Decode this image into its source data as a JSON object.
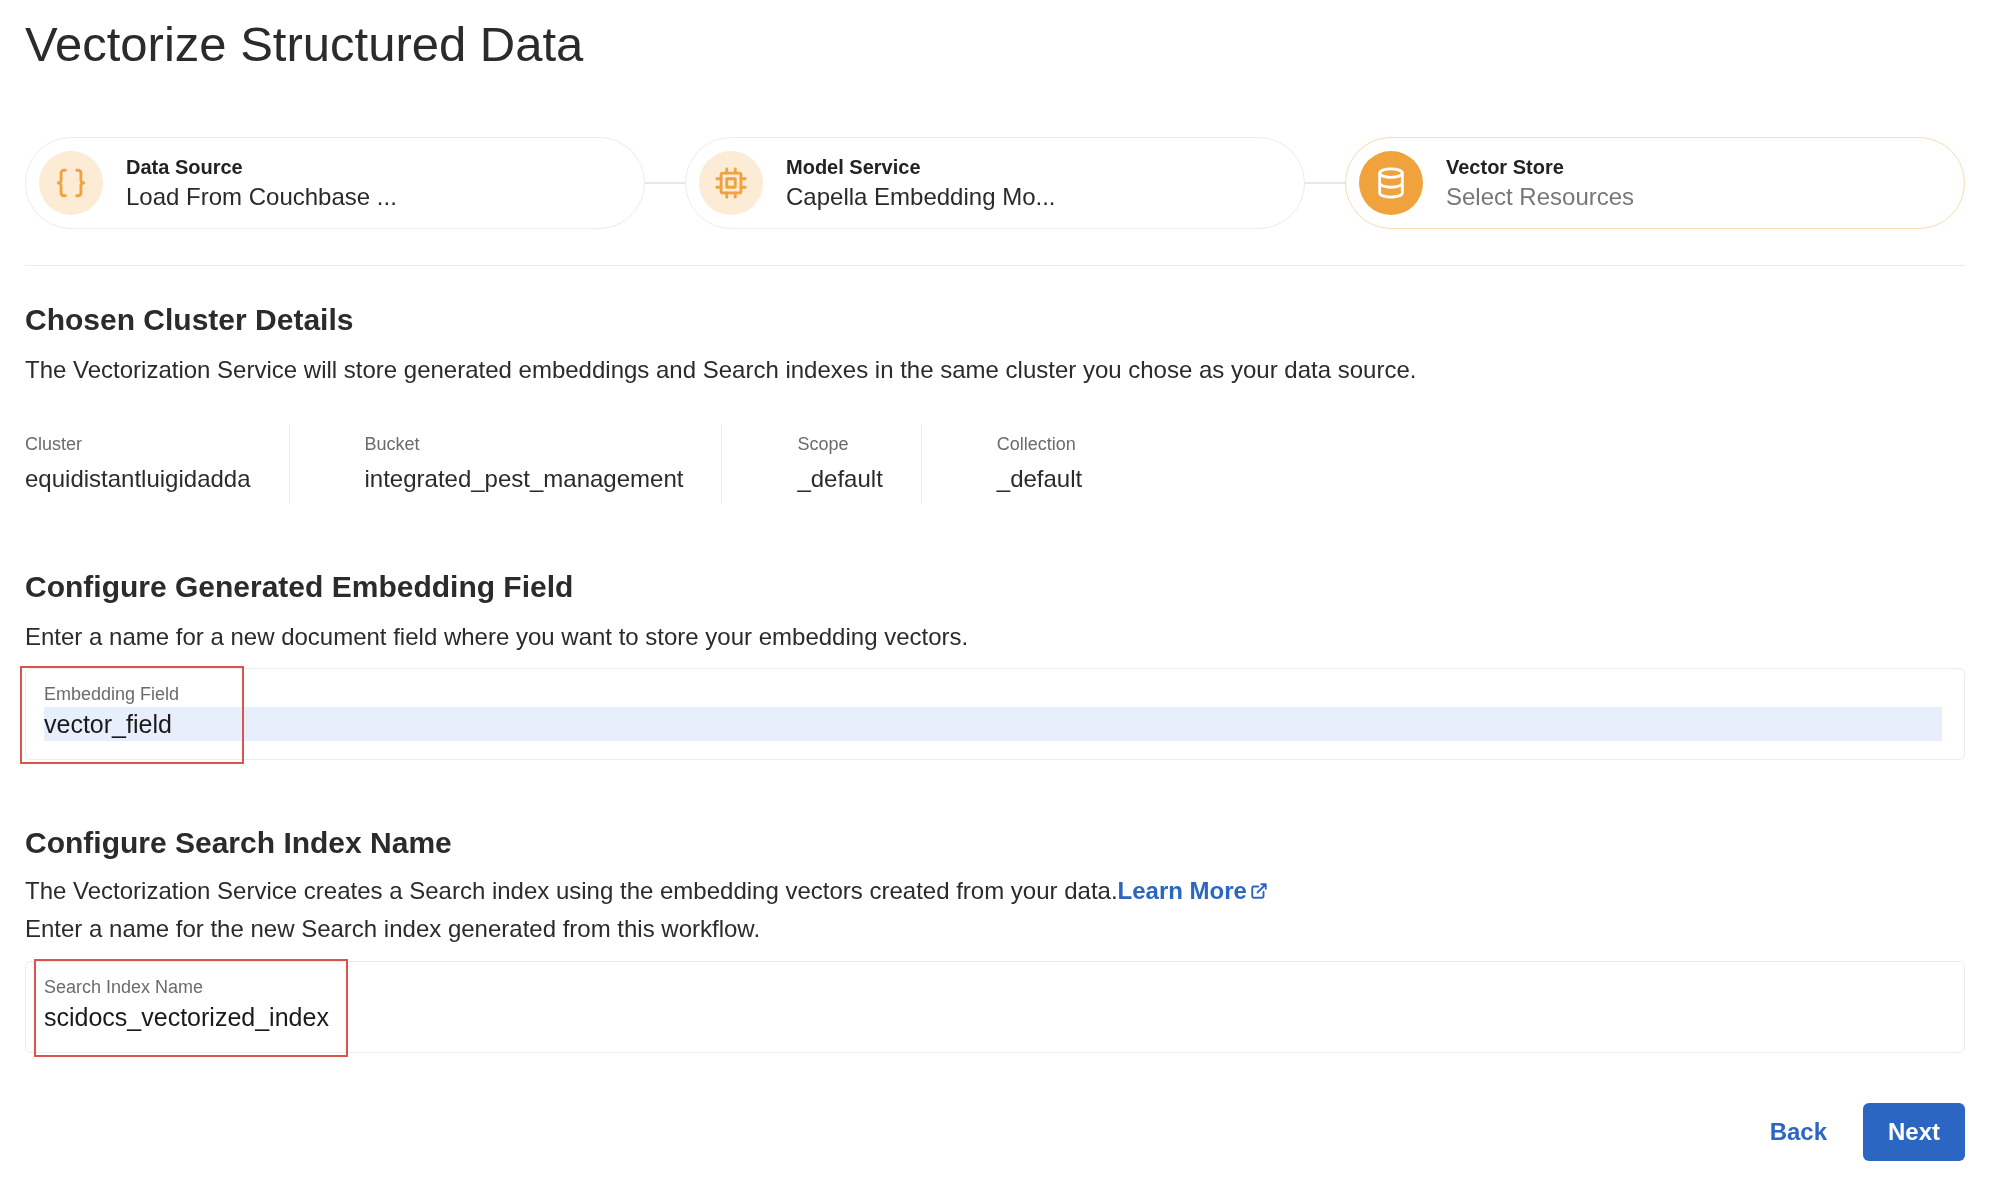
{
  "page": {
    "title": "Vectorize Structured Data"
  },
  "steps": [
    {
      "kind": "braces",
      "label": "Data Source",
      "value": "Load From Couchbase ...",
      "selected": false
    },
    {
      "kind": "chip",
      "label": "Model Service",
      "value": "Capella Embedding Mo...",
      "selected": false
    },
    {
      "kind": "database",
      "label": "Vector Store",
      "value": "Select Resources",
      "selected": true
    }
  ],
  "cluster_section": {
    "heading": "Chosen Cluster Details",
    "description": "The Vectorization Service will store generated embeddings and Search indexes in the same cluster you chose as your data source.",
    "details": [
      {
        "label": "Cluster",
        "value": "equidistantluigidadda"
      },
      {
        "label": "Bucket",
        "value": "integrated_pest_management"
      },
      {
        "label": "Scope",
        "value": "_default"
      },
      {
        "label": "Collection",
        "value": "_default"
      }
    ]
  },
  "embedding_section": {
    "heading": "Configure Generated Embedding Field",
    "description": "Enter a name for a new document field where you want to store your embedding vectors.",
    "field": {
      "label": "Embedding Field",
      "value": "vector_field",
      "text_selected": true,
      "annotated": true
    }
  },
  "index_section": {
    "heading": "Configure Search Index Name",
    "description": "The Vectorization Service creates a Search index using the embedding vectors created from your data.",
    "link": "Learn More",
    "note": "Enter a name for the new Search index generated from this workflow.",
    "field": {
      "label": "Search Index Name",
      "value": "scidocs_vectorized_index",
      "text_selected": false,
      "annotated": true
    }
  },
  "buttons": {
    "back": "Back",
    "next": "Next"
  }
}
